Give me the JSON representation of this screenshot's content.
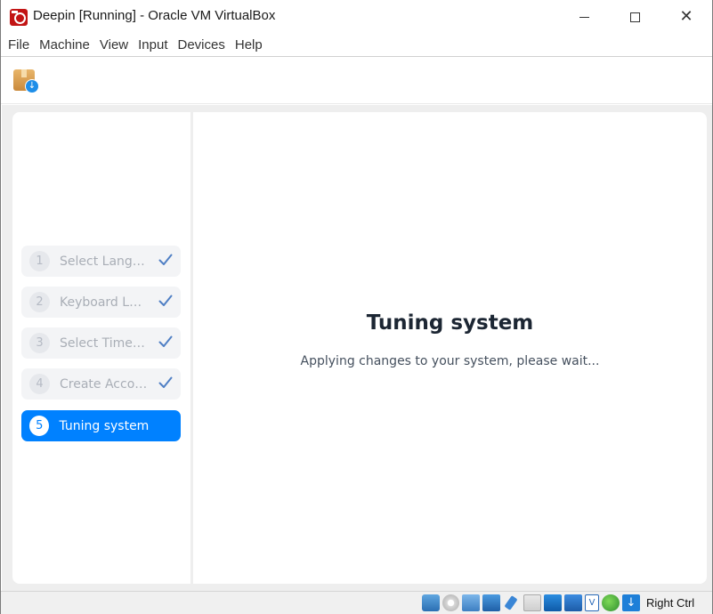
{
  "window": {
    "title": "Deepin [Running] - Oracle VM VirtualBox"
  },
  "menu": [
    "File",
    "Machine",
    "View",
    "Input",
    "Devices",
    "Help"
  ],
  "installer": {
    "steps": [
      {
        "number": "1",
        "label": "Select Language",
        "done": true
      },
      {
        "number": "2",
        "label": "Keyboard Layout",
        "done": true
      },
      {
        "number": "3",
        "label": "Select Timezone",
        "done": true
      },
      {
        "number": "4",
        "label": "Create Accounts",
        "done": true
      },
      {
        "number": "5",
        "label": "Tuning system",
        "done": false,
        "active": true
      }
    ],
    "main_title": "Tuning system",
    "main_subtitle": "Applying changes to your system, please wait..."
  },
  "statusbar": {
    "host_key": "Right Ctrl",
    "icons": [
      "hard-disk-icon",
      "optical-drive-icon",
      "audio-icon",
      "network-icon",
      "usb-icon",
      "shared-folders-icon",
      "display-icon",
      "recording-icon",
      "vt-x-icon",
      "mouse-integration-icon",
      "download-icon"
    ]
  },
  "colors": {
    "accent": "#0081ff",
    "step_bg": "#f3f4f6",
    "step_text": "#a9aeb6",
    "check": "#4f7fc4"
  }
}
